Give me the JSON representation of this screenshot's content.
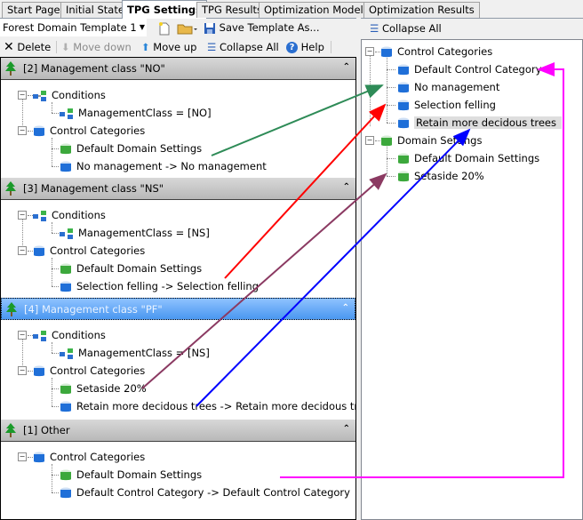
{
  "tabs": [
    {
      "label": "Start Page"
    },
    {
      "label": "Initial State"
    },
    {
      "label": "TPG Settings",
      "active": true
    },
    {
      "label": "TPG Results"
    },
    {
      "label": "Optimization Model"
    },
    {
      "label": "Optimization Results"
    }
  ],
  "left_toolbar": {
    "template_combo": "Forest Domain Template 1",
    "new_icon": "new-document-icon",
    "open_icon": "open-folder-icon",
    "save_as_label": "Save Template As...",
    "delete_label": "Delete",
    "move_down_label": "Move down",
    "move_up_label": "Move up",
    "collapse_all_label": "Collapse All",
    "help_label": "Help"
  },
  "groups": [
    {
      "title": "[2]  Management class \"NO\"",
      "condition": "ManagementClass =  [NO]",
      "conditions_label": "Conditions",
      "categories_label": "Control Categories",
      "domain": "Default Domain Settings",
      "category": "No management -> No management"
    },
    {
      "title": "[3]  Management class \"NS\"",
      "condition": "ManagementClass =  [NS]",
      "conditions_label": "Conditions",
      "categories_label": "Control Categories",
      "domain": "Default Domain Settings",
      "category": "Selection felling -> Selection felling"
    },
    {
      "title": "[4]  Management class \"PF\"",
      "selected": true,
      "condition": "ManagementClass =  [NS]",
      "conditions_label": "Conditions",
      "categories_label": "Control Categories",
      "domain": "Setaside 20%",
      "category": "Retain more decidous trees -> Retain more decidous trees"
    },
    {
      "title": "[1]  Other",
      "categories_label": "Control Categories",
      "domain": "Default Domain Settings",
      "category": "Default Control Category -> Default Control Category"
    }
  ],
  "right_toolbar": {
    "collapse_all_label": "Collapse All"
  },
  "right_tree": {
    "control_categories_label": "Control Categories",
    "control_categories": [
      "Default Control Category",
      "No management",
      "Selection felling",
      "Retain more decidous trees"
    ],
    "domain_settings_label": "Domain Settings",
    "domain_settings": [
      "Default Domain Settings",
      "Setaside 20%"
    ],
    "highlighted": "Retain more decidous trees"
  },
  "annotations": {
    "arrow_colors": {
      "green": "#2e8b57",
      "red": "#ff0000",
      "purple": "#8b3a62",
      "blue": "#0000ff",
      "magenta": "#ff00ff"
    }
  },
  "colors": {
    "selected_header": "#5aa5f5",
    "header": "#c8c8c8"
  }
}
